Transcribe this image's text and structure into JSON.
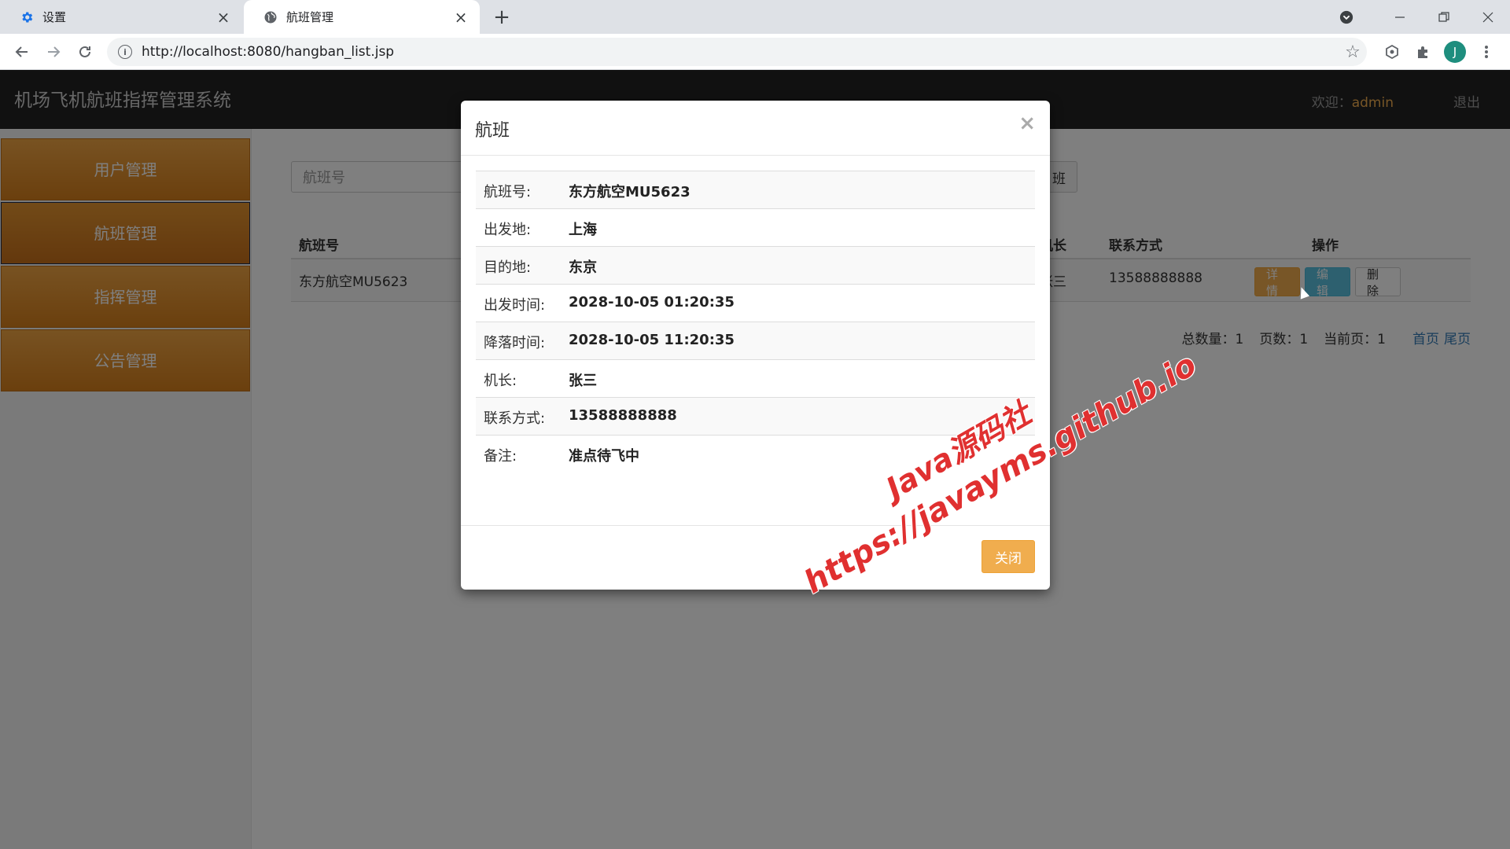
{
  "browser": {
    "tabs": [
      {
        "title": "设置",
        "icon": "gear-icon"
      },
      {
        "title": "航班管理",
        "icon": "globe-icon"
      }
    ],
    "url": "http://localhost:8080/hangban_list.jsp",
    "profile_initial": "J"
  },
  "app": {
    "title": "机场飞机航班指挥管理系统",
    "welcome_label": "欢迎：",
    "username": "admin",
    "logout_label": "退出"
  },
  "sidebar": {
    "items": [
      {
        "label": "用户管理"
      },
      {
        "label": "航班管理"
      },
      {
        "label": "指挥管理"
      },
      {
        "label": "公告管理"
      }
    ]
  },
  "main": {
    "search_placeholder": "航班号",
    "add_button_label": "班",
    "table": {
      "headers": {
        "flight_no": "航班号",
        "captain": "机长",
        "contact": "联系方式",
        "ops": "操作"
      },
      "rows": [
        {
          "flight_no": "东方航空MU5623",
          "captain": "张三",
          "contact": "13588888888"
        }
      ],
      "op_labels": {
        "detail": "详情",
        "edit": "编辑",
        "delete": "删除"
      }
    },
    "pager": {
      "total_label": "总数量：",
      "total": "1",
      "pages_label": "页数：",
      "pages": "1",
      "current_label": "当前页：",
      "current": "1",
      "first_label": "首页",
      "last_label": "尾页"
    }
  },
  "modal": {
    "title": "航班",
    "close_x": "×",
    "fields": [
      {
        "label": "航班号:",
        "value": "东方航空MU5623"
      },
      {
        "label": "出发地:",
        "value": "上海"
      },
      {
        "label": "目的地:",
        "value": "东京"
      },
      {
        "label": "出发时间:",
        "value": "2028-10-05 01:20:35"
      },
      {
        "label": "降落时间:",
        "value": "2028-10-05 11:20:35"
      },
      {
        "label": "机长:",
        "value": "张三"
      },
      {
        "label": "联系方式:",
        "value": "13588888888"
      },
      {
        "label": "备注:",
        "value": "准点待飞中"
      }
    ],
    "close_button_label": "关闭"
  },
  "watermark": {
    "line1": "Java源码社",
    "line2": "https://javayms.github.io"
  },
  "colors": {
    "accent_orange": "#f0ad4e",
    "info_blue": "#5bc0de",
    "header_dark": "#222222",
    "watermark_red": "#e03030"
  }
}
